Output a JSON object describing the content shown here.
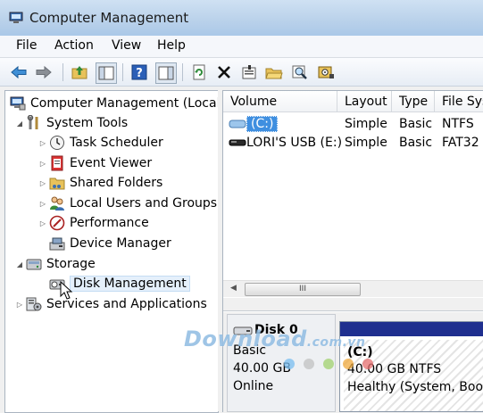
{
  "window": {
    "title": "Computer Management"
  },
  "menu": {
    "items": [
      "File",
      "Action",
      "View",
      "Help"
    ]
  },
  "toolbar": {
    "buttons": [
      "back-arrow-icon",
      "forward-arrow-icon",
      "up-folder-icon",
      "show-hide-tree-icon",
      "help-icon",
      "show-hide-action-pane-icon",
      "refresh-icon",
      "delete-icon",
      "properties-icon",
      "open-folder-icon",
      "find-icon",
      "disk-settings-icon"
    ]
  },
  "tree": {
    "root": "Computer Management (Local",
    "system_tools": "System Tools",
    "task_scheduler": "Task Scheduler",
    "event_viewer": "Event Viewer",
    "shared_folders": "Shared Folders",
    "local_users": "Local Users and Groups",
    "performance": "Performance",
    "device_manager": "Device Manager",
    "storage": "Storage",
    "disk_management": "Disk Management",
    "services": "Services and Applications"
  },
  "volumes": {
    "columns": [
      "Volume",
      "Layout",
      "Type",
      "File Sys"
    ],
    "rows": [
      {
        "volume": "(C:)",
        "layout": "Simple",
        "type": "Basic",
        "fs": "NTFS"
      },
      {
        "volume": "LORI'S USB (E:)",
        "layout": "Simple",
        "type": "Basic",
        "fs": "FAT32"
      }
    ],
    "scroll_thumb": "III"
  },
  "disk": {
    "name": "Disk 0",
    "kind": "Basic",
    "size": "40.00 GB",
    "status": "Online",
    "partition": {
      "label": "(C:)",
      "size_fs": "40.00 GB NTFS",
      "health": "Healthy (System, Boot,"
    }
  },
  "watermark": {
    "text": "Download",
    "suffix": ".com.vn"
  },
  "colors": {
    "accent": "#1f2f8f",
    "selection": "#e5f0fb"
  }
}
